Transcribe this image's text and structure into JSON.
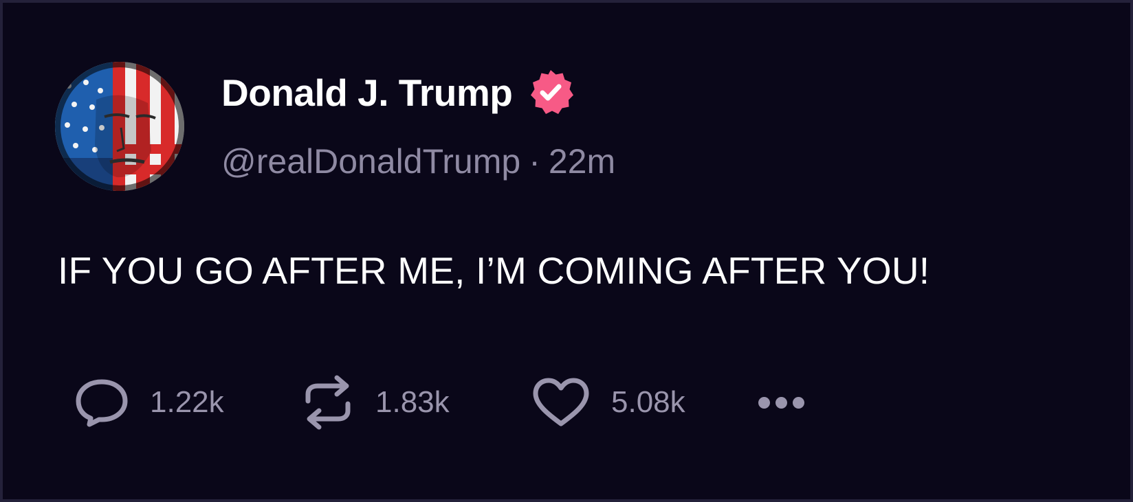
{
  "post": {
    "author": {
      "display_name": "Donald J. Trump",
      "handle": "@realDonaldTrump",
      "verified": true,
      "verified_badge_icon": "verified-badge-icon",
      "avatar_icon": "avatar-flag-portrait"
    },
    "separator": "·",
    "time_ago": "22m",
    "text": "IF YOU GO AFTER ME, I’M COMING AFTER YOU!",
    "actions": {
      "replies": {
        "icon": "reply-icon",
        "count": "1.22k"
      },
      "reposts": {
        "icon": "repost-icon",
        "count": "1.83k"
      },
      "likes": {
        "icon": "heart-icon",
        "count": "5.08k"
      },
      "more": {
        "icon": "more-icon"
      }
    }
  },
  "colors": {
    "background": "#0a0719",
    "text_primary": "#ffffff",
    "text_secondary": "#8f8aa3",
    "verified_badge": "#f75a86",
    "action_icon": "#9a95ad"
  }
}
